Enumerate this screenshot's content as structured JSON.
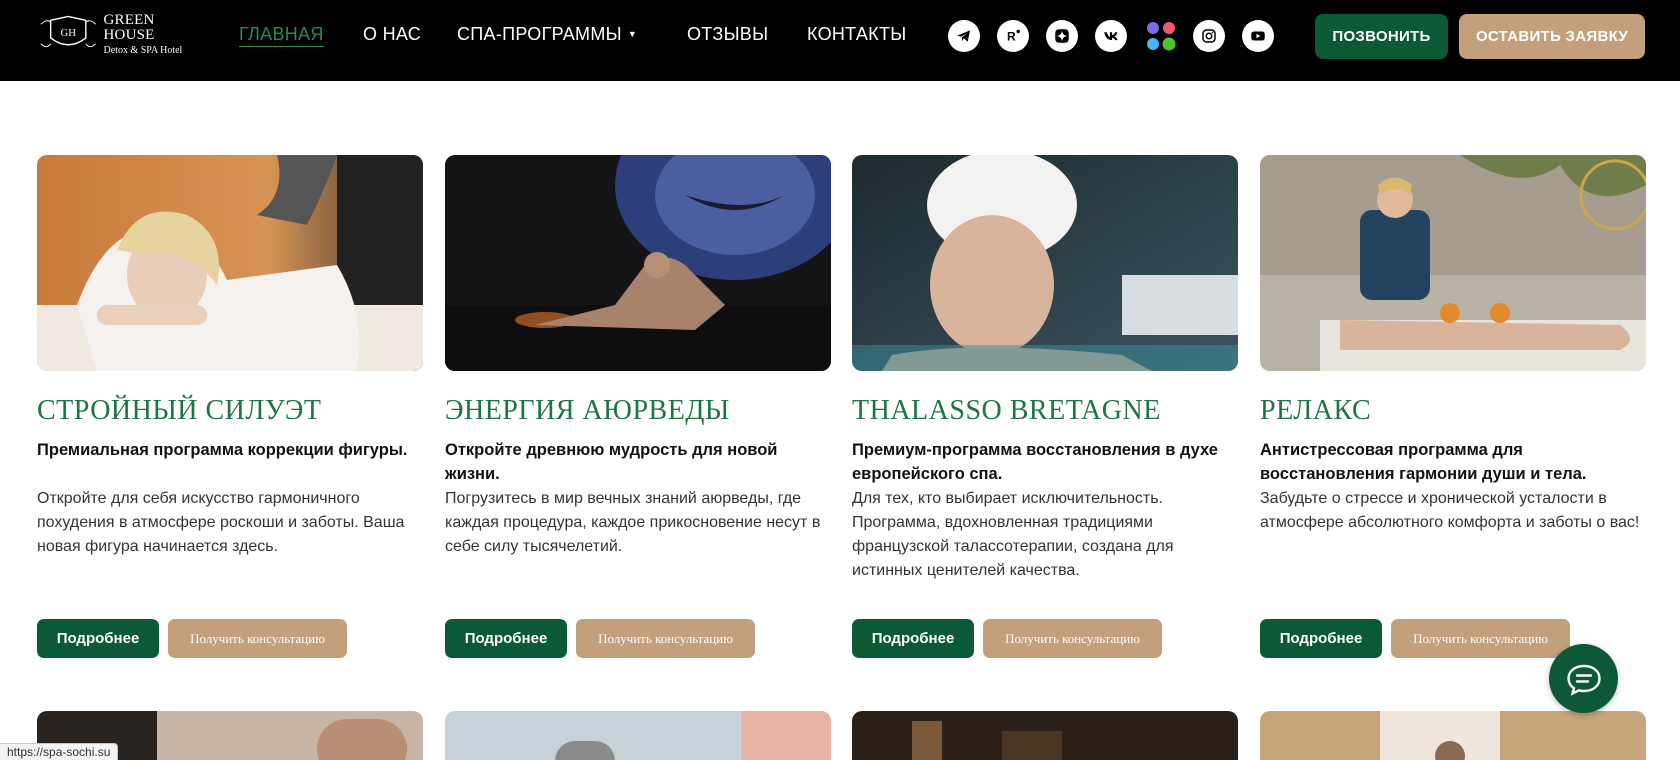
{
  "brand": {
    "title": "GREEN HOUSE",
    "subtitle": "Detox & SPA Hotel",
    "monogram": "GH"
  },
  "nav": {
    "items": [
      {
        "label": "ГЛАВНАЯ",
        "active": true
      },
      {
        "label": "О НАС"
      },
      {
        "label": "СПА-ПРОГРАММЫ",
        "has_dropdown": true
      },
      {
        "label": "ОТЗЫВЫ"
      },
      {
        "label": "КОНТАКТЫ"
      }
    ]
  },
  "social": [
    "telegram-icon",
    "rutube-icon",
    "dzen-icon",
    "vk-icon",
    "dots-app-icon",
    "instagram-icon",
    "youtube-icon"
  ],
  "header_buttons": {
    "call": "ПОЗВОНИТЬ",
    "request": "ОСТАВИТЬ ЗАЯВКУ"
  },
  "cards": [
    {
      "title": "СТРОЙНЫЙ СИЛУЭТ",
      "lead": "Премиальная программа коррекции фигуры.",
      "desc": "Откройте для себя искусство гармоничного похудения в атмосфере роскоши и заботы. Ваша новая фигура начинается здесь.",
      "more": "Подробнее",
      "consult": "Получить консультацию"
    },
    {
      "title": "ЭНЕРГИЯ АЮРВЕДЫ",
      "lead": "Откройте древнюю мудрость для новой жизни.",
      "desc": "Погрузитесь в мир вечных знаний аюрведы, где каждая процедура, каждое прикосновение несут в себе силу тысячелетий.",
      "more": "Подробнее",
      "consult": "Получить консультацию"
    },
    {
      "title": "THALASSO BRETAGNE",
      "lead": "Премиум-программа восстановления в духе европейского спа.",
      "desc": "Для тех, кто выбирает исключительность. Программа, вдохновленная традициями французской талассотерапии, создана для истинных ценителей качества.",
      "more": "Подробнее",
      "consult": "Получить консультацию"
    },
    {
      "title": "РЕЛАКС",
      "lead": "Антистрессовая программа для восстановления гармонии души и тела.",
      "desc": "Забудьте о стрессе и хронической усталости в атмосфере абсолютного комфорта и заботы о вас!",
      "more": "Подробнее",
      "consult": "Получить консультацию"
    }
  ],
  "status_url": "https://spa-sochi.su",
  "colors": {
    "brand_green": "#0b5a35",
    "title_green": "#1c7448",
    "accent_tan": "#c49f7c",
    "header_bg": "#000000"
  }
}
